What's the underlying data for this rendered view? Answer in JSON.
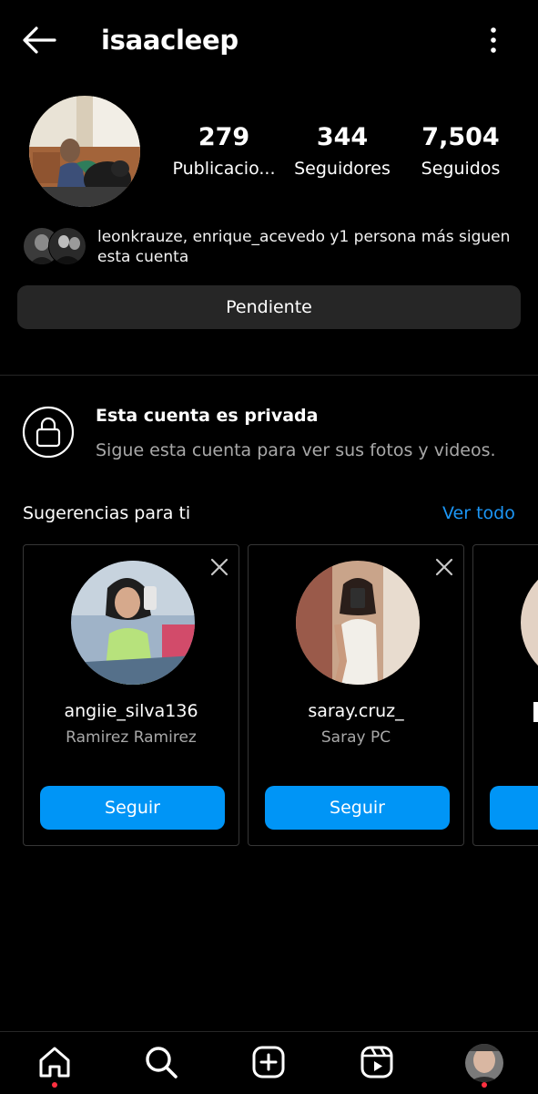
{
  "header": {
    "username": "isaacleep",
    "back_icon": "arrow-left-icon",
    "more_icon": "vertical-dots-icon"
  },
  "profile": {
    "stats": [
      {
        "value": "279",
        "label": "Publicacio..."
      },
      {
        "value": "344",
        "label": "Seguidores"
      },
      {
        "value": "7,504",
        "label": "Seguidos"
      }
    ],
    "followed_by_text": "leonkrauze, enrique_acevedo y1 persona más siguen esta cuenta",
    "pending_label": "Pendiente"
  },
  "private_notice": {
    "icon": "lock-icon",
    "title": "Esta cuenta es privada",
    "subtitle": "Sigue esta cuenta para ver sus fotos y videos."
  },
  "suggestions": {
    "title": "Sugerencias para ti",
    "see_all": "Ver todo",
    "cards": [
      {
        "username": "angiie_silva136",
        "name": "Ramirez Ramirez",
        "button": "Seguir"
      },
      {
        "username": "saray.cruz_",
        "name": "Saray PC",
        "button": "Seguir"
      }
    ]
  },
  "colors": {
    "background": "#000000",
    "accent_blue": "#0095f6",
    "link_blue": "#1c96f5",
    "secondary_text": "#a8a8a8",
    "notification_dot": "#ff3040"
  },
  "bottom_nav": {
    "icons": [
      "home-icon",
      "search-icon",
      "create-post-icon",
      "reels-icon",
      "profile-avatar"
    ]
  }
}
